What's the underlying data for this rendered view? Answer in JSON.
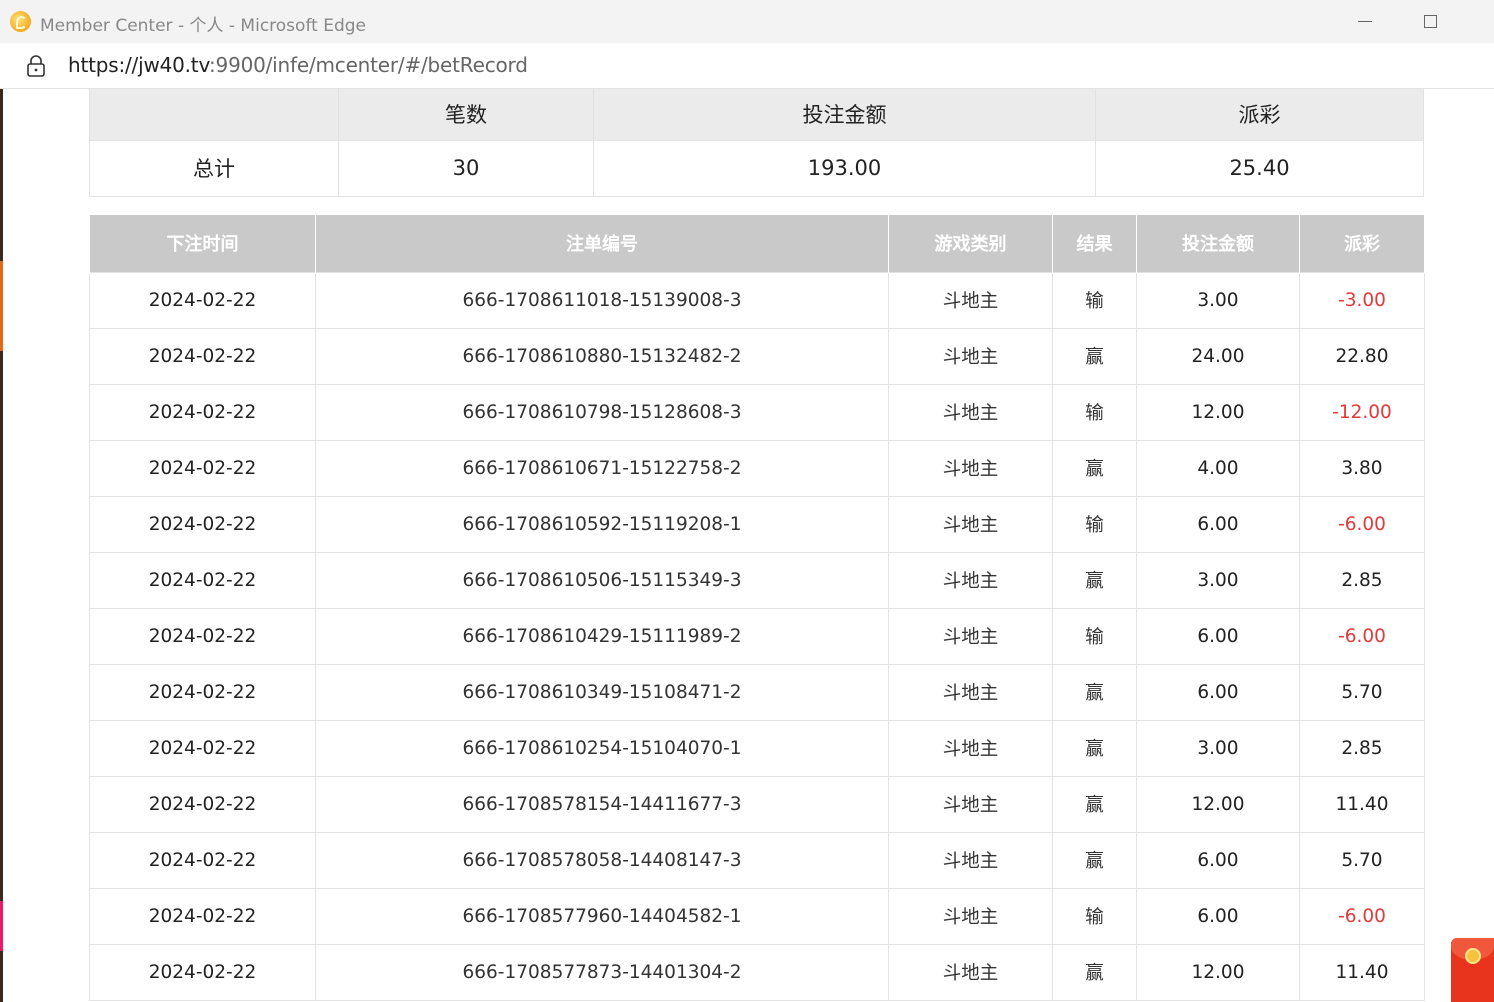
{
  "window": {
    "title": "Member Center - 个人 - Microsoft Edge"
  },
  "address": {
    "url_host": "https://jw40.tv",
    "url_rest": ":9900/infe/mcenter/#/betRecord"
  },
  "summary": {
    "headers": [
      "",
      "笔数",
      "投注金额",
      "派彩"
    ],
    "row": [
      "总计",
      "30",
      "193.00",
      "25.40"
    ]
  },
  "bets": {
    "headers": [
      "下注时间",
      "注单编号",
      "游戏类别",
      "结果",
      "投注金额",
      "派彩"
    ],
    "rows": [
      {
        "date": "2024-02-22",
        "order": "666-1708611018-15139008-3",
        "game": "斗地主",
        "result": "输",
        "amount": "3.00",
        "payout": "-3.00"
      },
      {
        "date": "2024-02-22",
        "order": "666-1708610880-15132482-2",
        "game": "斗地主",
        "result": "赢",
        "amount": "24.00",
        "payout": "22.80"
      },
      {
        "date": "2024-02-22",
        "order": "666-1708610798-15128608-3",
        "game": "斗地主",
        "result": "输",
        "amount": "12.00",
        "payout": "-12.00"
      },
      {
        "date": "2024-02-22",
        "order": "666-1708610671-15122758-2",
        "game": "斗地主",
        "result": "赢",
        "amount": "4.00",
        "payout": "3.80"
      },
      {
        "date": "2024-02-22",
        "order": "666-1708610592-15119208-1",
        "game": "斗地主",
        "result": "输",
        "amount": "6.00",
        "payout": "-6.00"
      },
      {
        "date": "2024-02-22",
        "order": "666-1708610506-15115349-3",
        "game": "斗地主",
        "result": "赢",
        "amount": "3.00",
        "payout": "2.85"
      },
      {
        "date": "2024-02-22",
        "order": "666-1708610429-15111989-2",
        "game": "斗地主",
        "result": "输",
        "amount": "6.00",
        "payout": "-6.00"
      },
      {
        "date": "2024-02-22",
        "order": "666-1708610349-15108471-2",
        "game": "斗地主",
        "result": "赢",
        "amount": "6.00",
        "payout": "5.70"
      },
      {
        "date": "2024-02-22",
        "order": "666-1708610254-15104070-1",
        "game": "斗地主",
        "result": "赢",
        "amount": "3.00",
        "payout": "2.85"
      },
      {
        "date": "2024-02-22",
        "order": "666-1708578154-14411677-3",
        "game": "斗地主",
        "result": "赢",
        "amount": "12.00",
        "payout": "11.40"
      },
      {
        "date": "2024-02-22",
        "order": "666-1708578058-14408147-3",
        "game": "斗地主",
        "result": "赢",
        "amount": "6.00",
        "payout": "5.70"
      },
      {
        "date": "2024-02-22",
        "order": "666-1708577960-14404582-1",
        "game": "斗地主",
        "result": "输",
        "amount": "6.00",
        "payout": "-6.00"
      },
      {
        "date": "2024-02-22",
        "order": "666-1708577873-14401304-2",
        "game": "斗地主",
        "result": "赢",
        "amount": "12.00",
        "payout": "11.40"
      }
    ]
  },
  "colors": {
    "negative_payout": "#e23a3a",
    "header_bg": "#c9c9c9",
    "summary_header_bg": "#ebebeb"
  }
}
